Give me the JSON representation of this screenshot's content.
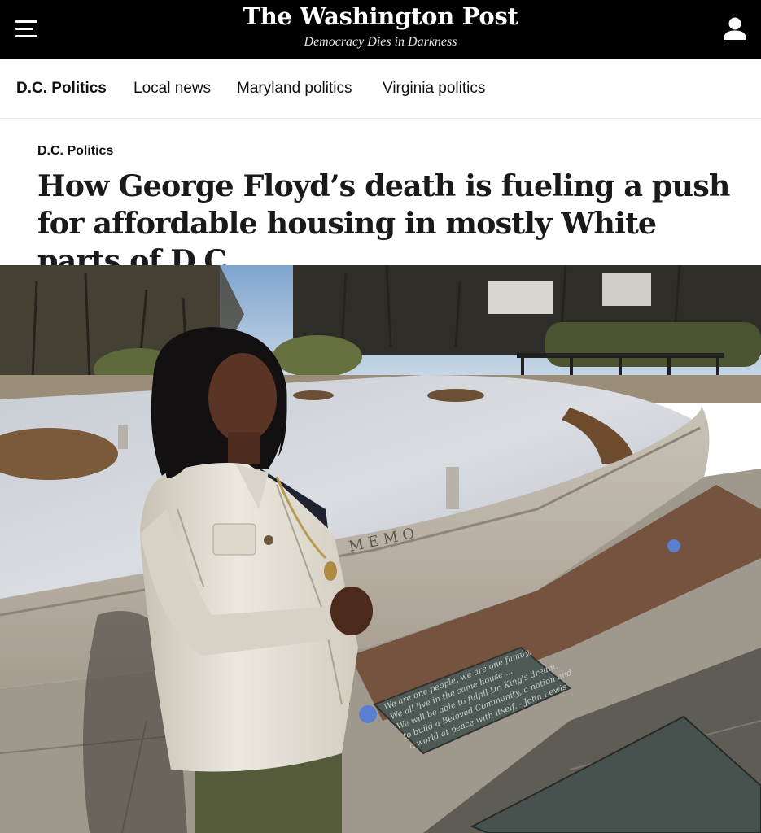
{
  "masthead": {
    "logo": "The Washington Post",
    "tagline": "Democracy Dies in Darkness",
    "menu_icon": "hamburger-menu-icon",
    "account_icon": "user-account-icon"
  },
  "nav": {
    "items": [
      {
        "label": "D.C. Politics",
        "active": true
      },
      {
        "label": "Local news",
        "active": false
      },
      {
        "label": "Maryland politics",
        "active": false
      },
      {
        "label": "Virginia politics",
        "active": false
      }
    ]
  },
  "article": {
    "kicker": "D.C. Politics",
    "headline": "How George Floyd’s death is fueling a push for affordable housing in mostly White parts of D.C."
  },
  "photo": {
    "memorial_letters": "M E M O",
    "plaque_text": [
      "We are one people, we are one family,",
      "We all live in the same house ...",
      "We will be able to fulfill Dr. King's dream,",
      "to build a Beloved Community, a nation and",
      "a world at peace with itself. - John Lewis"
    ]
  },
  "colors": {
    "masthead_bg": "#000000",
    "masthead_text": "#ffffff",
    "nav_text": "#111111",
    "headline_text": "#1a1a1a"
  }
}
